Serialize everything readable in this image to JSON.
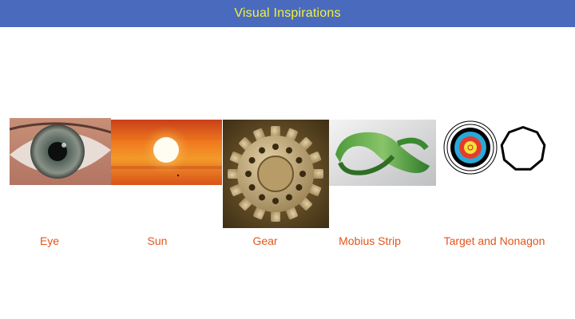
{
  "header": {
    "title": "Visual Inspirations",
    "background": "#4a6bbd",
    "text_color": "#f2f23a"
  },
  "captions": {
    "eye": "Eye",
    "sun": "Sun",
    "gear": "Gear",
    "mobius": "Mobius Strip",
    "target_nonagon": "Target and Nonagon"
  },
  "caption_color": "#e3541c",
  "images": [
    {
      "name": "eye-photo",
      "depicts": "close-up of a human eye"
    },
    {
      "name": "sun-photo",
      "depicts": "sun in an orange sky"
    },
    {
      "name": "gear-photo",
      "depicts": "metal gear / sprocket"
    },
    {
      "name": "mobius-photo",
      "depicts": "green mobius strip"
    },
    {
      "name": "target-nonagon-image",
      "depicts": "archery target and nonagon outline"
    }
  ]
}
